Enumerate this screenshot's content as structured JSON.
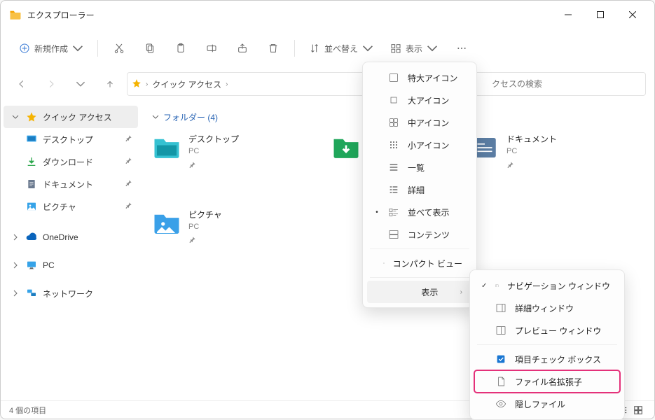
{
  "window": {
    "title": "エクスプローラー"
  },
  "toolbar": {
    "new": "新規作成",
    "sort": "並べ替え",
    "view": "表示"
  },
  "breadcrumb": {
    "root": "クイック アクセス"
  },
  "search": {
    "placeholder": "クセスの検索"
  },
  "sidebar": {
    "quick": "クイック アクセス",
    "desktop": "デスクトップ",
    "downloads": "ダウンロード",
    "documents": "ドキュメント",
    "pictures": "ピクチャ",
    "onedrive": "OneDrive",
    "pc": "PC",
    "network": "ネットワーク"
  },
  "group": {
    "label": "フォルダー (4)"
  },
  "items": {
    "desktop": {
      "name": "デスクトップ",
      "sub": "PC"
    },
    "downloads": {
      "name": "",
      "sub": ""
    },
    "documents": {
      "name": "ドキュメント",
      "sub": "PC"
    },
    "pictures": {
      "name": "ピクチャ",
      "sub": "PC"
    }
  },
  "viewMenu": {
    "extraLarge": "特大アイコン",
    "large": "大アイコン",
    "medium": "中アイコン",
    "small": "小アイコン",
    "list": "一覧",
    "details": "詳細",
    "tiles": "並べて表示",
    "content": "コンテンツ",
    "compact": "コンパクト ビュー",
    "show": "表示"
  },
  "showMenu": {
    "navPane": "ナビゲーション ウィンドウ",
    "detailsPane": "詳細ウィンドウ",
    "previewPane": "プレビュー ウィンドウ",
    "itemCheck": "項目チェック ボックス",
    "fileExt": "ファイル名拡張子",
    "hidden": "隠しファイル"
  },
  "status": {
    "count": "4 個の項目"
  }
}
